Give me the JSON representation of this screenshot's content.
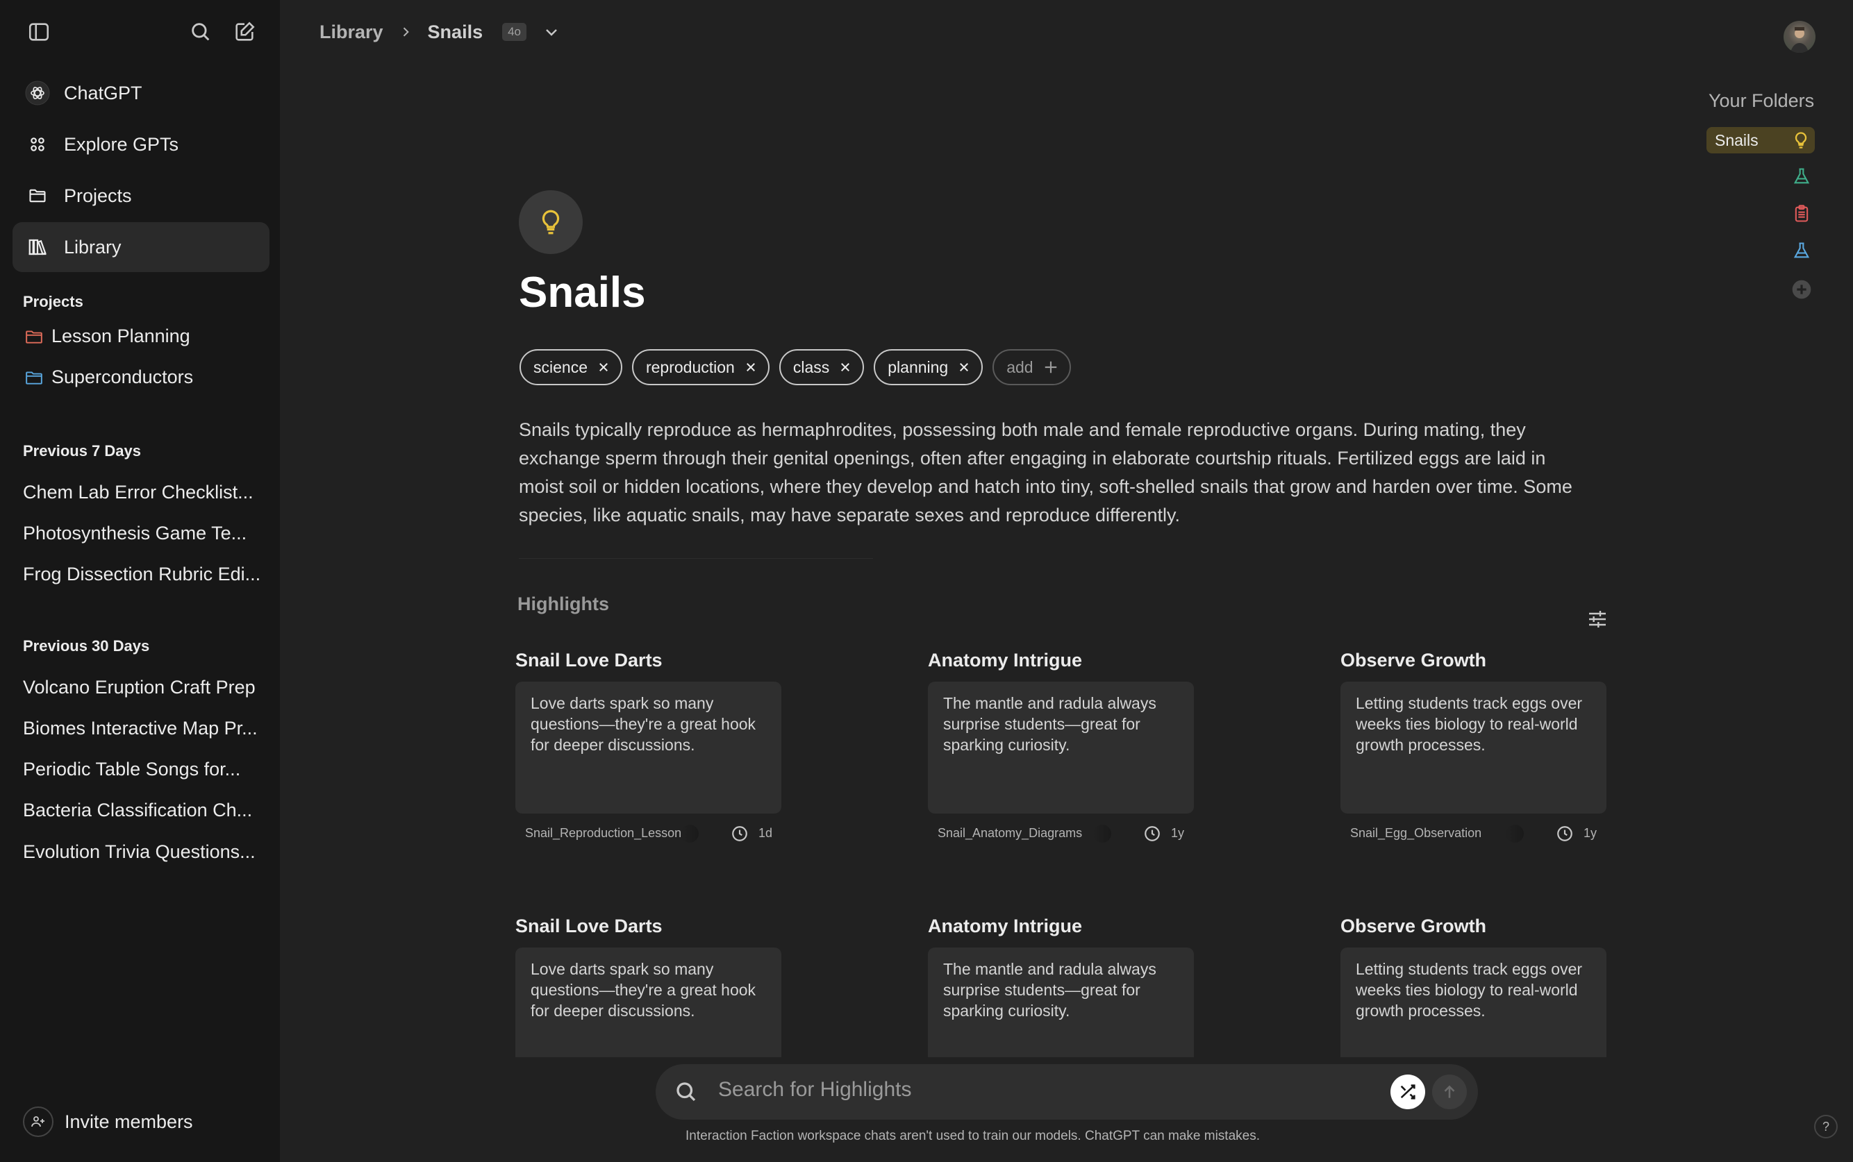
{
  "sidebar": {
    "nav": [
      {
        "label": "ChatGPT",
        "icon": "chatgpt-logo-icon"
      },
      {
        "label": "Explore GPTs",
        "icon": "grid-icon"
      },
      {
        "label": "Projects",
        "icon": "folder-icon"
      },
      {
        "label": "Library",
        "icon": "library-icon",
        "active": true
      }
    ],
    "projects_heading": "Projects",
    "projects": [
      {
        "label": "Lesson Planning",
        "color": "#e06c5a"
      },
      {
        "label": "Superconductors",
        "color": "#5aa8e0"
      }
    ],
    "prev7_heading": "Previous 7 Days",
    "prev7": [
      "Chem Lab Error Checklist...",
      "Photosynthesis Game Te...",
      "Frog Dissection Rubric Edi..."
    ],
    "prev30_heading": "Previous 30 Days",
    "prev30": [
      "Volcano Eruption Craft Prep",
      "Biomes Interactive Map Pr...",
      "Periodic Table Songs for...",
      "Bacteria Classification Ch...",
      "Evolution Trivia Questions..."
    ],
    "invite_label": "Invite members"
  },
  "header": {
    "breadcrumb_root": "Library",
    "breadcrumb_current": "Snails",
    "model_badge": "4o"
  },
  "folders": {
    "title": "Your Folders",
    "active": "Snails",
    "icons": [
      "flask-icon",
      "clipboard-icon",
      "flask-icon",
      "add-circle-icon"
    ],
    "colors": {
      "active_bg": "#4b4222",
      "bulb": "#e8c23a",
      "flask": "#3fae8a",
      "clipboard": "#e05a5a"
    }
  },
  "page": {
    "title": "Snails",
    "tags": [
      "science",
      "reproduction",
      "class",
      "planning"
    ],
    "add_tag_label": "add",
    "description": "Snails typically reproduce as hermaphrodites, possessing both male and female reproductive organs. During mating, they exchange sperm through their genital openings, often after engaging in elaborate courtship rituals. Fertilized eggs are laid in moist soil or hidden locations, where they develop and hatch into tiny, soft-shelled snails that grow and harden over time. Some species, like aquatic snails, may have separate sexes and reproduce differently.",
    "highlights_title": "Highlights"
  },
  "highlights": [
    {
      "title": "Snail Love Darts",
      "text": "Love darts spark so many questions—they're a great hook for deeper discussions.",
      "source": "Snail_Reproduction_Lesson",
      "age": "1d"
    },
    {
      "title": "Anatomy Intrigue",
      "text": "The mantle and radula always surprise students—great for sparking curiosity.",
      "source": "Snail_Anatomy_Diagrams",
      "age": "1y"
    },
    {
      "title": "Observe Growth",
      "text": "Letting students track eggs over weeks ties biology to real-world growth processes.",
      "source": "Snail_Egg_Observation",
      "age": "1y"
    },
    {
      "title": "Snail Love Darts",
      "text": "Love darts spark so many questions—they're a great hook for deeper discussions."
    },
    {
      "title": "Anatomy Intrigue",
      "text": "The mantle and radula always surprise students—great for sparking curiosity."
    },
    {
      "title": "Observe Growth",
      "text": "Letting students track eggs over weeks ties biology to real-world growth processes."
    }
  ],
  "search": {
    "placeholder": "Search for Highlights"
  },
  "footer_note": "Interaction Faction workspace chats aren't used to train our models. ChatGPT can make mistakes.",
  "help_label": "?"
}
